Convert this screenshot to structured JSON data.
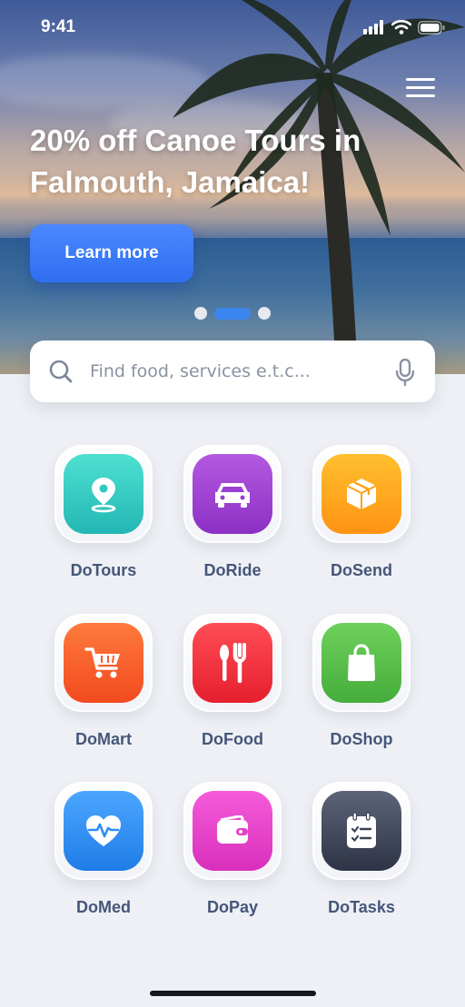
{
  "status_bar": {
    "time": "9:41"
  },
  "promo": {
    "title": "20% off Canoe Tours in Falmouth, Jamaica!",
    "cta_label": "Learn more",
    "slides_total": 3,
    "active_slide": 2
  },
  "search": {
    "placeholder": "Find food, services e.t.c..."
  },
  "services": [
    {
      "label": "DoTours",
      "icon": "map-pin-icon",
      "color": "#2ec9c0"
    },
    {
      "label": "DoRide",
      "icon": "car-icon",
      "color": "#9b3fd1"
    },
    {
      "label": "DoSend",
      "icon": "package-icon",
      "color": "#ffa21a"
    },
    {
      "label": "DoMart",
      "icon": "cart-icon",
      "color": "#ff5a2a"
    },
    {
      "label": "DoFood",
      "icon": "cutlery-icon",
      "color": "#ff2f3e"
    },
    {
      "label": "DoShop",
      "icon": "shopping-bag-icon",
      "color": "#59c04a"
    },
    {
      "label": "DoMed",
      "icon": "heart-pulse-icon",
      "color": "#2f8df0"
    },
    {
      "label": "DoPay",
      "icon": "wallet-icon",
      "color": "#e63fc9"
    },
    {
      "label": "DoTasks",
      "icon": "clipboard-icon",
      "color": "#3b4255"
    }
  ]
}
